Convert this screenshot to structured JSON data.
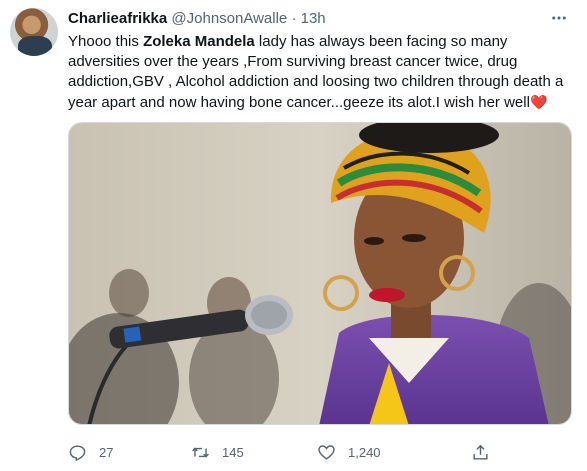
{
  "tweet": {
    "author_name": "Charlieafrikka",
    "handle": "@JohnsonAwalle",
    "separator": "·",
    "time": "13h",
    "text_part1": "Yhooo this ",
    "text_bold": "Zoleka Mandela",
    "text_part2": " lady has always been facing  so many adversities over the years ,From surviving breast cancer twice, drug addiction,GBV , Alcohol addiction and loosing two children through death a year apart and now having bone cancer...geeze its alot.I wish her well",
    "heart": "❤️",
    "media_icon": "photo-of-woman-at-microphone"
  },
  "actions": {
    "reply_count": "27",
    "retweet_count": "145",
    "like_count": "1,240"
  },
  "colors": {
    "text": "#0f1419",
    "muted": "#536471",
    "heart": "#e0245e"
  }
}
